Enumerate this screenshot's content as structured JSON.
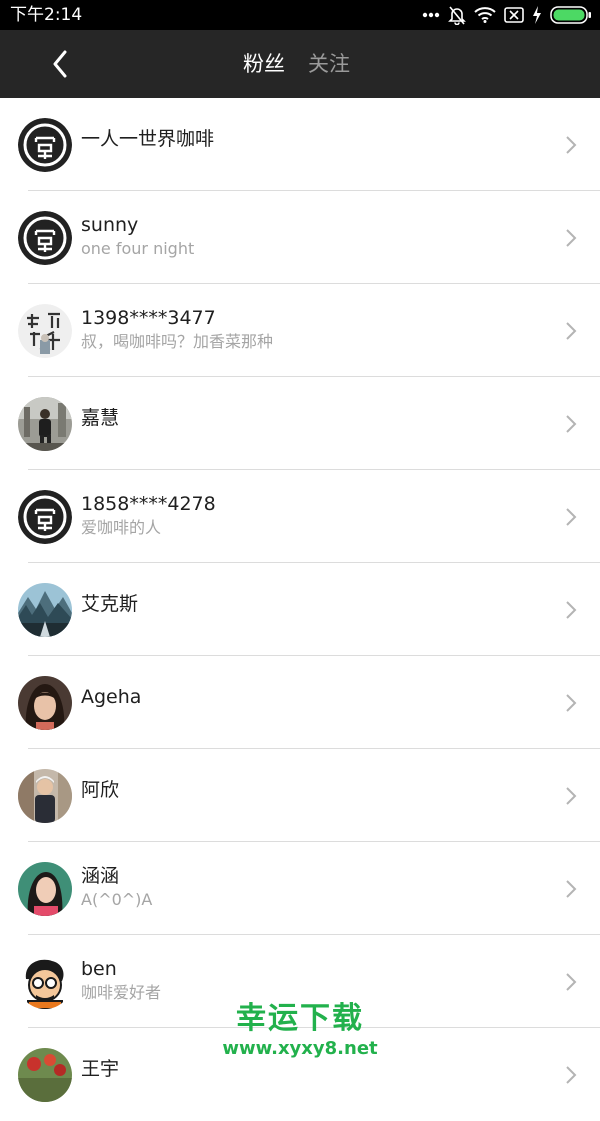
{
  "status_bar": {
    "time": "下午2:14",
    "icons": [
      "more-dots-icon",
      "bell-off-icon",
      "wifi-icon",
      "sim-x-icon",
      "charging-icon",
      "battery-icon"
    ]
  },
  "nav": {
    "back_icon": "chevron-left-icon",
    "tabs": [
      {
        "label": "粉丝",
        "active": true
      },
      {
        "label": "关注",
        "active": false
      }
    ]
  },
  "fans": [
    {
      "name": "一人一世界咖啡",
      "subtitle": "",
      "avatar": "logo-avatar"
    },
    {
      "name": "sunny",
      "subtitle": " one four night",
      "avatar": "logo-avatar"
    },
    {
      "name": "1398****3477",
      "subtitle": "叔，喝咖啡吗？加香菜那种",
      "avatar": "calligraphy-avatar"
    },
    {
      "name": "嘉慧",
      "subtitle": "",
      "avatar": "photo-avatar"
    },
    {
      "name": "1858****4278",
      "subtitle": "爱咖啡的人",
      "avatar": "logo-avatar"
    },
    {
      "name": "艾克斯",
      "subtitle": "",
      "avatar": "landscape-avatar"
    },
    {
      "name": "Ageha",
      "subtitle": "",
      "avatar": "portrait-avatar"
    },
    {
      "name": "阿欣",
      "subtitle": "",
      "avatar": "photo-avatar"
    },
    {
      "name": "涵涵",
      "subtitle": "A(^0^)A",
      "avatar": "portrait-avatar"
    },
    {
      "name": "ben",
      "subtitle": "咖啡爱好者",
      "avatar": "cartoon-avatar"
    },
    {
      "name": "王宇",
      "subtitle": "",
      "avatar": "photo-avatar"
    }
  ],
  "watermark": {
    "title": "幸运下载",
    "url": "www.xyxy8.net"
  },
  "colors": {
    "nav_background": "#262626",
    "watermark_green": "#22b14c"
  }
}
